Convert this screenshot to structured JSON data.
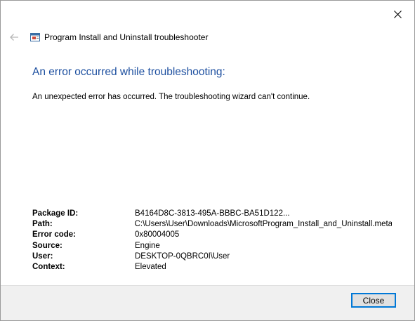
{
  "window": {
    "title": "Program Install and Uninstall troubleshooter"
  },
  "icons": {
    "back": "back-arrow-icon",
    "close": "close-icon",
    "app": "troubleshooter-icon"
  },
  "main": {
    "heading": "An error occurred while troubleshooting:",
    "message": "An unexpected error has occurred. The troubleshooting wizard can't continue."
  },
  "details": [
    {
      "label": "Package ID:",
      "value": "B4164D8C-3813-495A-BBBC-BA51D122..."
    },
    {
      "label": "Path:",
      "value": "C:\\Users\\User\\Downloads\\MicrosoftProgram_Install_and_Uninstall.meta"
    },
    {
      "label": "Error code:",
      "value": "0x80004005"
    },
    {
      "label": "Source:",
      "value": "Engine"
    },
    {
      "label": "User:",
      "value": "DESKTOP-0QBRC0I\\User"
    },
    {
      "label": "Context:",
      "value": "Elevated"
    }
  ],
  "footer": {
    "close_label": "Close"
  },
  "colors": {
    "heading": "#1e50a0",
    "footer_bg": "#f0f0f0",
    "button_border": "#0078d7"
  }
}
